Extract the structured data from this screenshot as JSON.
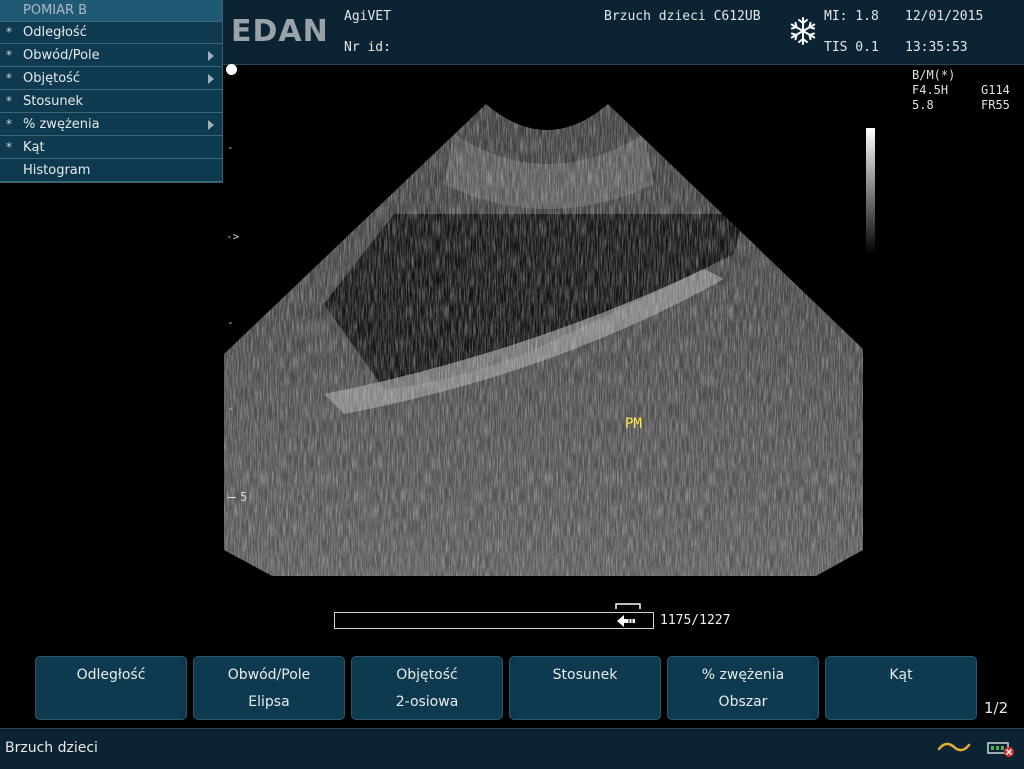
{
  "header": {
    "logo": "EDAN",
    "institution": "AgiVET",
    "patient_id_label": "Nr id:",
    "exam": "Brzuch dzieci C612UB",
    "mi": "MI: 1.8",
    "tis": "TIS 0.1",
    "date": "12/01/2015",
    "time": "13:35:53"
  },
  "menu": {
    "title": "POMIAR B",
    "items": [
      {
        "star": "*",
        "label": "Odległość",
        "submenu": false
      },
      {
        "star": "*",
        "label": "Obwód/Pole",
        "submenu": true
      },
      {
        "star": "*",
        "label": "Objętość",
        "submenu": true
      },
      {
        "star": "*",
        "label": "Stosunek",
        "submenu": false
      },
      {
        "star": "*",
        "label": "% zwężenia",
        "submenu": true
      },
      {
        "star": "*",
        "label": "Kąt",
        "submenu": false
      },
      {
        "star": "",
        "label": "Histogram",
        "submenu": false
      }
    ]
  },
  "params": {
    "mode": "B/M(*)",
    "freq": "F4.5H",
    "gain": "G114",
    "depth": "5.8",
    "frame_rate": "FR55"
  },
  "image": {
    "annotation": "PM",
    "focus_marker": "->",
    "depth_label": "5"
  },
  "cine": {
    "counter": "1175/1227",
    "position": 0.958
  },
  "softkeys": [
    {
      "line1": "Odległość",
      "line2": ""
    },
    {
      "line1": "Obwód/Pole",
      "line2": "Elipsa"
    },
    {
      "line1": "Objętość",
      "line2": "2-osiowa"
    },
    {
      "line1": "Stosunek",
      "line2": ""
    },
    {
      "line1": "% zwężenia",
      "line2": "Obszar"
    },
    {
      "line1": "Kąt",
      "line2": ""
    }
  ],
  "page_indicator": "1/2",
  "status": {
    "text": "Brzuch dzieci"
  },
  "colors": {
    "panel": "#0e3a50",
    "header": "#0b2333",
    "annotation": "#ffe84a",
    "accent_icon": "#e0b030"
  }
}
